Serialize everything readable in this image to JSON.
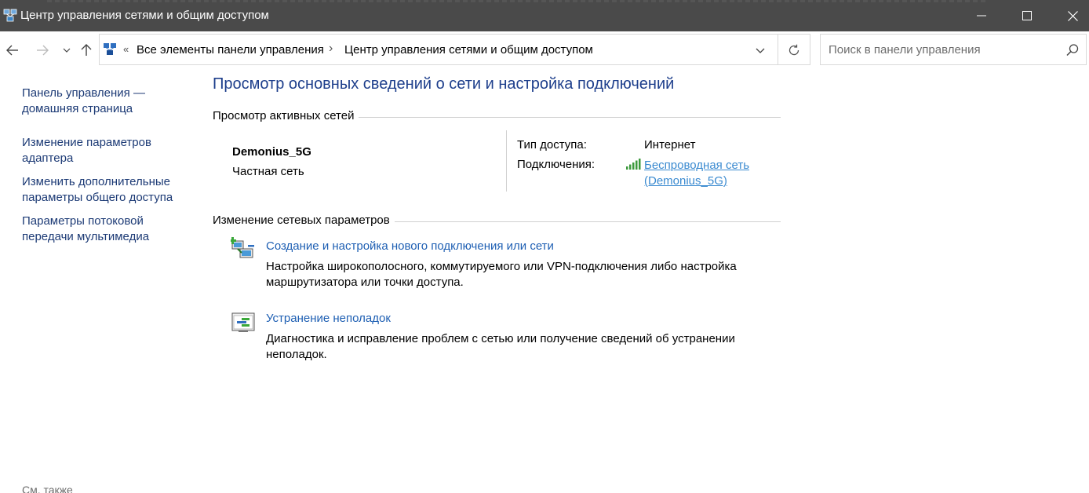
{
  "window": {
    "title": "Центр управления сетями и общим доступом",
    "icon": "control-panel-network-icon",
    "controls": {
      "minimize": "minimize-icon",
      "maximize": "maximize-icon",
      "close": "close-icon"
    },
    "title_bar_color": "#4a4a4a"
  },
  "navigation": {
    "back_icon": "arrow-left-icon",
    "forward_icon": "arrow-right-icon",
    "recent_icon": "chevron-down-icon",
    "up_icon": "arrow-up-icon"
  },
  "address": {
    "separator_overflow": "«",
    "crumbs": [
      "Все элементы панели управления",
      "Центр управления сетями и общим доступом"
    ],
    "separator": "›",
    "dropdown_icon": "chevron-down-icon",
    "refresh_icon": "refresh-icon"
  },
  "search": {
    "placeholder": "Поиск в панели управления",
    "value": "",
    "icon": "search-icon"
  },
  "sidebar": {
    "items": [
      {
        "lines": [
          "Панель управления —",
          "домашняя страница"
        ]
      },
      {
        "lines": [
          "Изменение параметров",
          "адаптера"
        ]
      },
      {
        "lines": [
          "Изменить дополнительные",
          "параметры общего доступа"
        ]
      },
      {
        "lines": [
          "Параметры потоковой",
          "передачи мультимедиа"
        ]
      }
    ],
    "see_also": "См. также"
  },
  "main": {
    "title": "Просмотр основных сведений о сети и настройка подключений",
    "active_networks": {
      "header": "Просмотр активных сетей",
      "network_name": "Demonius_5G",
      "network_type": "Частная сеть",
      "access_type_label": "Тип доступа:",
      "access_type_value": "Интернет",
      "connections_label": "Подключения:",
      "connection_link_lines": [
        "Беспроводная сеть",
        "(Demonius_5G)"
      ],
      "signal_icon": "wifi-signal-icon"
    },
    "change_settings": {
      "header": "Изменение сетевых параметров",
      "tasks": [
        {
          "icon": "new-connection-icon",
          "title": "Создание и настройка нового подключения или сети",
          "desc_lines": [
            "Настройка широкополосного, коммутируемого или VPN-подключения либо настройка",
            "маршрутизатора или точки доступа."
          ]
        },
        {
          "icon": "troubleshoot-icon",
          "title": "Устранение неполадок",
          "desc_lines": [
            "Диагностика и исправление проблем с сетью или получение сведений об устранении",
            "неполадок."
          ]
        }
      ]
    }
  },
  "colors": {
    "heading_blue": "#1e3f8c",
    "link_blue": "#1e5fb3",
    "sidebar_link": "#1c3a75",
    "connection_link": "#3a8ad0"
  }
}
